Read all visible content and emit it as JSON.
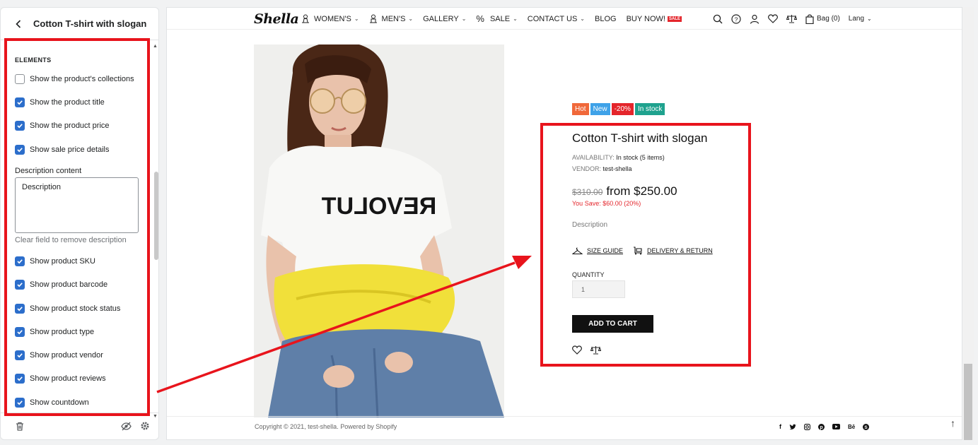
{
  "editor": {
    "title": "Cotton T-shirt with slogan",
    "section_label": "ELEMENTS",
    "settings": [
      {
        "label": "Show the product's collections",
        "checked": false
      },
      {
        "label": "Show the product title",
        "checked": true
      },
      {
        "label": "Show the product price",
        "checked": true
      },
      {
        "label": "Show sale price details",
        "checked": true
      }
    ],
    "description": {
      "label": "Description content",
      "value": "Description",
      "help": "Clear field to remove description"
    },
    "settings2": [
      {
        "label": "Show product SKU",
        "checked": true
      },
      {
        "label": "Show product barcode",
        "checked": true
      },
      {
        "label": "Show product stock status",
        "checked": true
      },
      {
        "label": "Show product type",
        "checked": true
      },
      {
        "label": "Show product vendor",
        "checked": true
      },
      {
        "label": "Show product reviews",
        "checked": true
      },
      {
        "label": "Show countdown",
        "checked": true
      }
    ]
  },
  "store": {
    "logo": "Shella",
    "menu": [
      {
        "label": "WOMEN'S",
        "icon": "woman-icon",
        "dropdown": true
      },
      {
        "label": "MEN'S",
        "icon": "man-icon",
        "dropdown": true
      },
      {
        "label": "GALLERY",
        "icon": "",
        "dropdown": true
      },
      {
        "label": "SALE",
        "icon": "percent-icon",
        "dropdown": true
      },
      {
        "label": "CONTACT US",
        "icon": "",
        "dropdown": true
      },
      {
        "label": "BLOG",
        "icon": "",
        "dropdown": false
      },
      {
        "label": "BUY NOW!",
        "icon": "",
        "dropdown": false,
        "badge": "SALE"
      }
    ],
    "bag_label": "Bag (0)",
    "lang_label": "Lang"
  },
  "product": {
    "badges": [
      {
        "text": "Hot",
        "color": "#f0683a"
      },
      {
        "text": "New",
        "color": "#3fa2e8"
      },
      {
        "text": "-20%",
        "color": "#e4252b"
      },
      {
        "text": "In stock",
        "color": "#1fa28e"
      }
    ],
    "title": "Cotton T-shirt with slogan",
    "availability_label": "AVAILABILITY:",
    "availability_value": "In stock (5 items)",
    "vendor_label": "VENDOR:",
    "vendor_value": "test-shella",
    "price_old": "$310.00",
    "price_new": "from $250.00",
    "save_text": "You Save: $60.00 (20%)",
    "description": "Description",
    "size_guide": "SIZE GUIDE",
    "delivery": "DELIVERY & RETURN",
    "quantity_label": "QUANTITY",
    "quantity_value": "1",
    "add_to_cart": "ADD TO CART",
    "shirt_text": "REVOLUT"
  },
  "footer": {
    "copyright": "Copyright © 2021, test-shella. Powered by Shopify",
    "social": [
      "facebook-icon",
      "twitter-icon",
      "instagram-icon",
      "pinterest-icon",
      "youtube-icon",
      "behance-icon",
      "skype-icon"
    ]
  },
  "colors": {
    "accent": "#2c6ecb",
    "highlight": "#e8141c",
    "sale": "#e4252b"
  }
}
